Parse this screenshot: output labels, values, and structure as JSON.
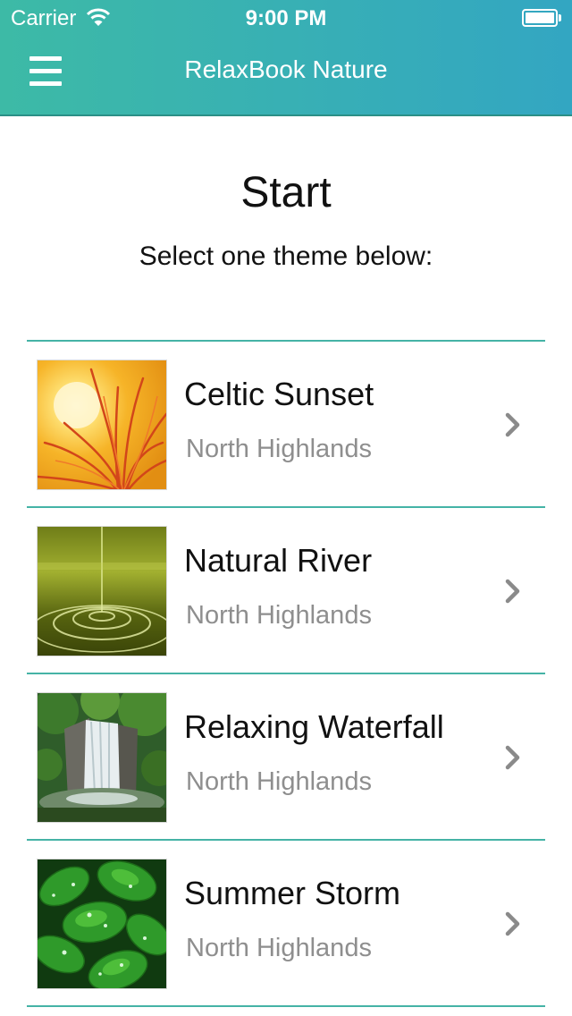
{
  "status_bar": {
    "carrier": "Carrier",
    "time": "9:00 PM"
  },
  "nav": {
    "title": "RelaxBook Nature"
  },
  "page": {
    "title": "Start",
    "subtitle": "Select one theme below:"
  },
  "themes": [
    {
      "title": "Celtic Sunset",
      "subtitle": "North Highlands"
    },
    {
      "title": "Natural River",
      "subtitle": "North Highlands"
    },
    {
      "title": "Relaxing Waterfall",
      "subtitle": "North Highlands"
    },
    {
      "title": "Summer Storm",
      "subtitle": "North Highlands"
    }
  ],
  "colors": {
    "header_start": "#3dbaa6",
    "header_end": "#33a6c2",
    "separator": "#45b3a6",
    "subtitle": "#8e8e8e"
  }
}
